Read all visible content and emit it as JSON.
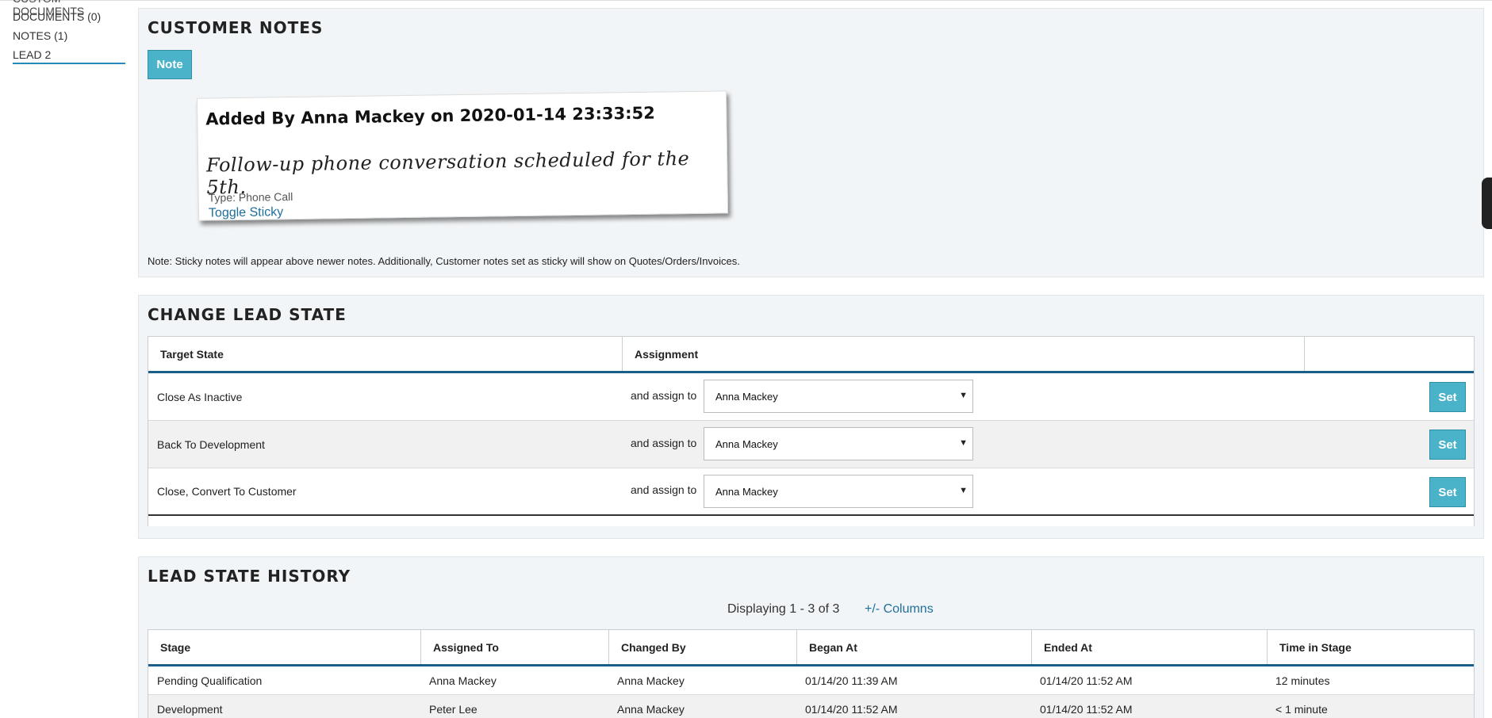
{
  "sidebar": {
    "cut_item": "Custom Documents",
    "items": [
      {
        "label": "DOCUMENTS (0)"
      },
      {
        "label": "NOTES (1)"
      },
      {
        "label": "LEAD 2"
      }
    ]
  },
  "customer_notes": {
    "title": "CUSTOMER NOTES",
    "note_button": "Note",
    "sticky": {
      "title": "Added By Anna Mackey on 2020-01-14 23:33:52",
      "body": "Follow-up phone conversation scheduled for the 5th.",
      "type": "Type: Phone Call",
      "toggle": "Toggle Sticky"
    },
    "footnote": "Note: Sticky notes will appear above newer notes. Additionally, Customer notes set as sticky will show on Quotes/Orders/Invoices."
  },
  "change_lead_state": {
    "title": "CHANGE LEAD STATE",
    "headers": {
      "target": "Target State",
      "assignment": "Assignment"
    },
    "assign_label": "and assign to",
    "set_label": "Set",
    "rows": [
      {
        "target": "Close As Inactive",
        "assignee": "Anna Mackey"
      },
      {
        "target": "Back To Development",
        "assignee": "Anna Mackey"
      },
      {
        "target": "Close, Convert To Customer",
        "assignee": "Anna Mackey"
      }
    ]
  },
  "lead_state_history": {
    "title": "LEAD STATE HISTORY",
    "displaying": "Displaying 1 - 3 of 3",
    "columns_link": "+/- Columns",
    "headers": [
      "Stage",
      "Assigned To",
      "Changed By",
      "Began At",
      "Ended At",
      "Time in Stage"
    ],
    "rows": [
      [
        "Pending Qualification",
        "Anna Mackey",
        "Anna Mackey",
        "01/14/20 11:39 AM",
        "01/14/20 11:52 AM",
        "12 minutes"
      ],
      [
        "Development",
        "Peter Lee",
        "Anna Mackey",
        "01/14/20 11:52 AM",
        "01/14/20 11:52 AM",
        "< 1 minute"
      ]
    ]
  }
}
